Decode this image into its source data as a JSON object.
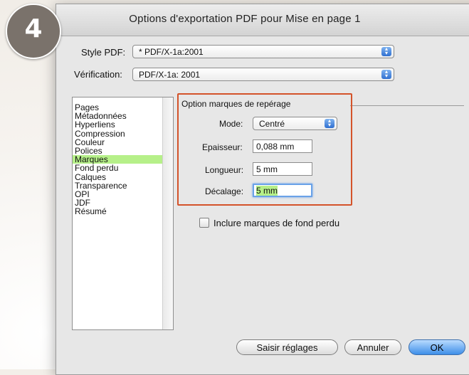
{
  "step_number": "4",
  "dialog": {
    "title": "Options d'exportation PDF pour Mise en page 1",
    "style_pdf": {
      "label": "Style PDF:",
      "value": "* PDF/X-1a:2001"
    },
    "verification": {
      "label": "Vérification:",
      "value": "PDF/X-1a: 2001"
    }
  },
  "categories": [
    "Pages",
    "Métadonnées",
    "Hyperliens",
    "Compression",
    "Couleur",
    "Polices",
    "Marques",
    "Fond perdu",
    "Calques",
    "Transparence",
    "OPI",
    "JDF",
    "Résumé"
  ],
  "selected_category": "Marques",
  "marks_panel": {
    "group_title": "Option marques de repérage",
    "mode": {
      "label": "Mode:",
      "value": "Centré"
    },
    "epaisseur": {
      "label": "Epaisseur:",
      "value": "0,088 mm"
    },
    "longueur": {
      "label": "Longueur:",
      "value": "5 mm"
    },
    "decalage": {
      "label": "Décalage:",
      "value": "5 mm"
    },
    "include_bleed_marks": {
      "label": "Inclure marques de fond perdu",
      "checked": false
    }
  },
  "buttons": {
    "save_settings": "Saisir réglages",
    "cancel": "Annuler",
    "ok": "OK"
  },
  "colors": {
    "highlight": "#b6f089",
    "callout_border": "#d4532a",
    "badge": "#7a726b"
  }
}
